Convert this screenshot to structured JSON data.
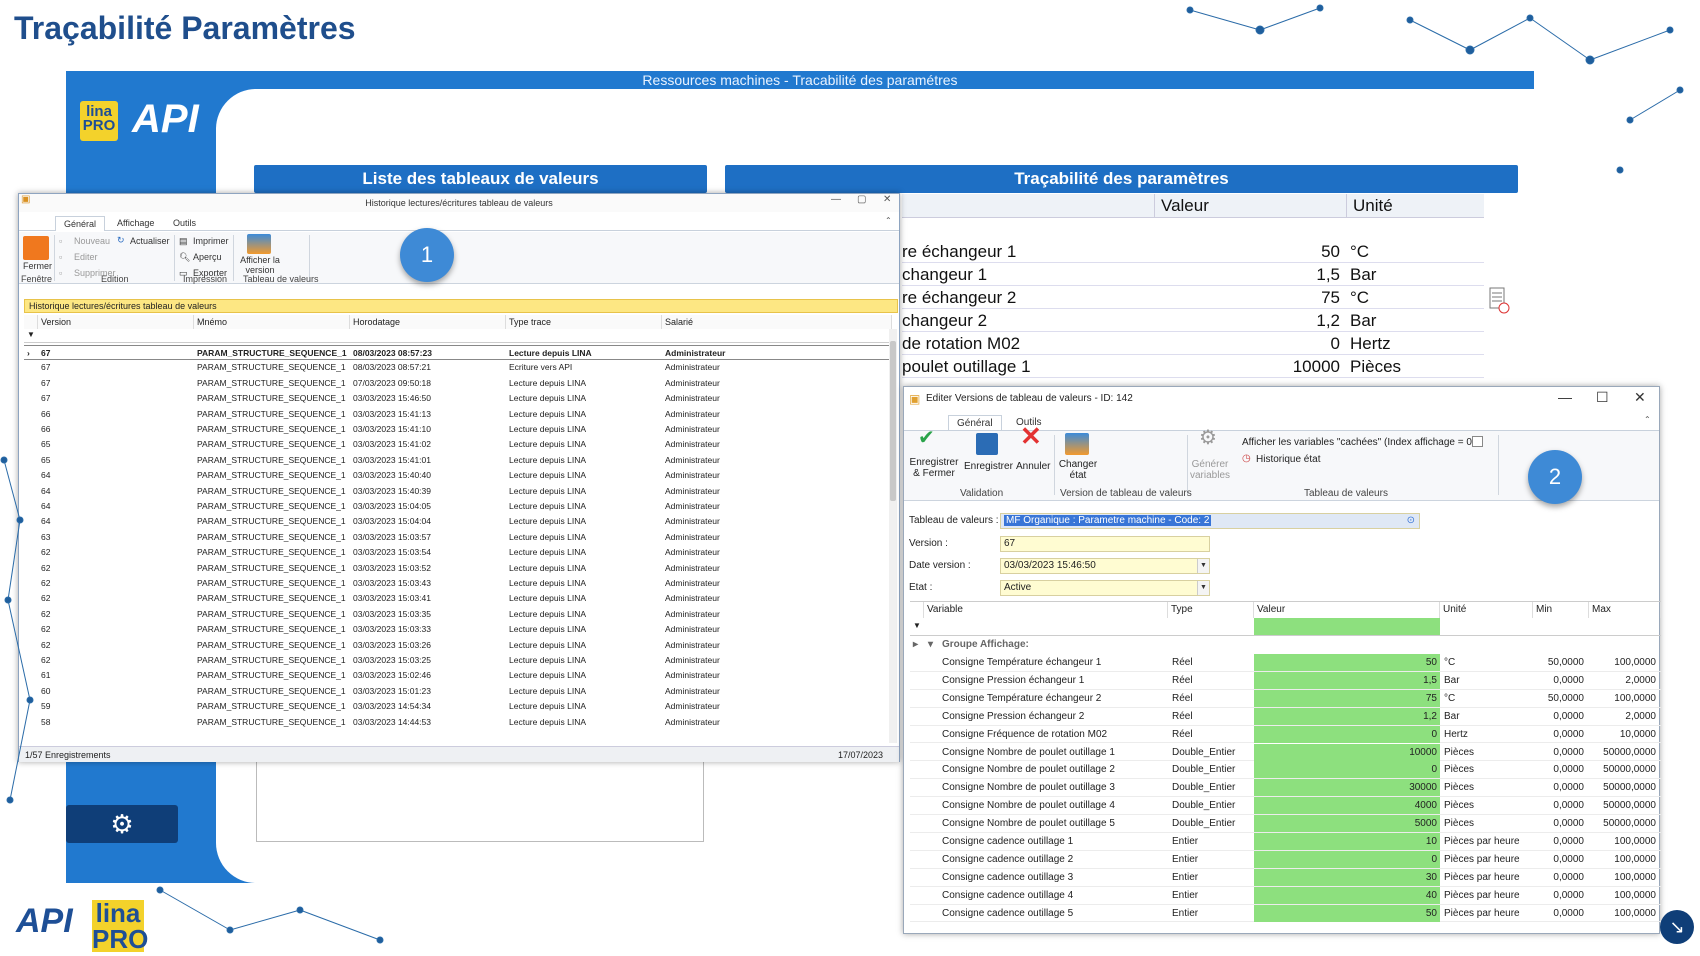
{
  "slide_title": "Traçabilité Paramètres",
  "bg_app": {
    "title": "Ressources machines - Tracabilité des paramétres",
    "logo_lina": "lina PRO",
    "logo_api": "API",
    "header_left": "Liste des tableaux de valeurs",
    "header_right": "Traçabilité des paramètres",
    "table_headers": {
      "valeur": "Valeur",
      "unite": "Unité"
    },
    "rows": [
      {
        "label": "re échangeur 1",
        "value": "50",
        "unit": "°C"
      },
      {
        "label": "changeur 1",
        "value": "1,5",
        "unit": "Bar"
      },
      {
        "label": "re échangeur 2",
        "value": "75",
        "unit": "°C"
      },
      {
        "label": "changeur 2",
        "value": "1,2",
        "unit": "Bar"
      },
      {
        "label": "de rotation M02",
        "value": "0",
        "unit": "Hertz"
      },
      {
        "label": "poulet outillage 1",
        "value": "10000",
        "unit": "Pièces"
      }
    ]
  },
  "win1": {
    "title": "Historique lectures/écritures tableau de valeurs",
    "tabs": [
      "Général",
      "Affichage",
      "Outils"
    ],
    "ribbon": {
      "fermer": "Fermer",
      "nouveau": "Nouveau",
      "actualiser": "Actualiser",
      "editer": "Editer",
      "supprimer": "Supprimer",
      "imprimer": "Imprimer",
      "apercu": "Aperçu",
      "exporter": "Exporter",
      "afficher_version": "Afficher la version",
      "groups": [
        "Fenêtre",
        "Edition",
        "Impression",
        "Tableau de valeurs"
      ]
    },
    "section_label": "Historique lectures/écritures tableau de valeurs",
    "columns": [
      "Version",
      "Mnémo",
      "Horodatage",
      "Type trace",
      "Salarié"
    ],
    "rows": [
      [
        "67",
        "PARAM_STRUCTURE_SEQUENCE_1",
        "08/03/2023 08:57:23",
        "Lecture depuis LINA",
        "Administrateur"
      ],
      [
        "67",
        "PARAM_STRUCTURE_SEQUENCE_1",
        "08/03/2023 08:57:21",
        "Ecriture vers API",
        "Administrateur"
      ],
      [
        "67",
        "PARAM_STRUCTURE_SEQUENCE_1",
        "07/03/2023 09:50:18",
        "Lecture depuis LINA",
        "Administrateur"
      ],
      [
        "67",
        "PARAM_STRUCTURE_SEQUENCE_1",
        "03/03/2023 15:46:50",
        "Lecture depuis LINA",
        "Administrateur"
      ],
      [
        "66",
        "PARAM_STRUCTURE_SEQUENCE_1",
        "03/03/2023 15:41:13",
        "Lecture depuis LINA",
        "Administrateur"
      ],
      [
        "66",
        "PARAM_STRUCTURE_SEQUENCE_1",
        "03/03/2023 15:41:10",
        "Lecture depuis LINA",
        "Administrateur"
      ],
      [
        "65",
        "PARAM_STRUCTURE_SEQUENCE_1",
        "03/03/2023 15:41:02",
        "Lecture depuis LINA",
        "Administrateur"
      ],
      [
        "65",
        "PARAM_STRUCTURE_SEQUENCE_1",
        "03/03/2023 15:41:01",
        "Lecture depuis LINA",
        "Administrateur"
      ],
      [
        "64",
        "PARAM_STRUCTURE_SEQUENCE_1",
        "03/03/2023 15:40:40",
        "Lecture depuis LINA",
        "Administrateur"
      ],
      [
        "64",
        "PARAM_STRUCTURE_SEQUENCE_1",
        "03/03/2023 15:40:39",
        "Lecture depuis LINA",
        "Administrateur"
      ],
      [
        "64",
        "PARAM_STRUCTURE_SEQUENCE_1",
        "03/03/2023 15:04:05",
        "Lecture depuis LINA",
        "Administrateur"
      ],
      [
        "64",
        "PARAM_STRUCTURE_SEQUENCE_1",
        "03/03/2023 15:04:04",
        "Lecture depuis LINA",
        "Administrateur"
      ],
      [
        "63",
        "PARAM_STRUCTURE_SEQUENCE_1",
        "03/03/2023 15:03:57",
        "Lecture depuis LINA",
        "Administrateur"
      ],
      [
        "62",
        "PARAM_STRUCTURE_SEQUENCE_1",
        "03/03/2023 15:03:54",
        "Lecture depuis LINA",
        "Administrateur"
      ],
      [
        "62",
        "PARAM_STRUCTURE_SEQUENCE_1",
        "03/03/2023 15:03:52",
        "Lecture depuis LINA",
        "Administrateur"
      ],
      [
        "62",
        "PARAM_STRUCTURE_SEQUENCE_1",
        "03/03/2023 15:03:43",
        "Lecture depuis LINA",
        "Administrateur"
      ],
      [
        "62",
        "PARAM_STRUCTURE_SEQUENCE_1",
        "03/03/2023 15:03:41",
        "Lecture depuis LINA",
        "Administrateur"
      ],
      [
        "62",
        "PARAM_STRUCTURE_SEQUENCE_1",
        "03/03/2023 15:03:35",
        "Lecture depuis LINA",
        "Administrateur"
      ],
      [
        "62",
        "PARAM_STRUCTURE_SEQUENCE_1",
        "03/03/2023 15:03:33",
        "Lecture depuis LINA",
        "Administrateur"
      ],
      [
        "62",
        "PARAM_STRUCTURE_SEQUENCE_1",
        "03/03/2023 15:03:26",
        "Lecture depuis LINA",
        "Administrateur"
      ],
      [
        "62",
        "PARAM_STRUCTURE_SEQUENCE_1",
        "03/03/2023 15:03:25",
        "Lecture depuis LINA",
        "Administrateur"
      ],
      [
        "61",
        "PARAM_STRUCTURE_SEQUENCE_1",
        "03/03/2023 15:02:46",
        "Lecture depuis LINA",
        "Administrateur"
      ],
      [
        "60",
        "PARAM_STRUCTURE_SEQUENCE_1",
        "03/03/2023 15:01:23",
        "Lecture depuis LINA",
        "Administrateur"
      ],
      [
        "59",
        "PARAM_STRUCTURE_SEQUENCE_1",
        "03/03/2023 14:54:34",
        "Lecture depuis LINA",
        "Administrateur"
      ],
      [
        "58",
        "PARAM_STRUCTURE_SEQUENCE_1",
        "03/03/2023 14:44:53",
        "Lecture depuis LINA",
        "Administrateur"
      ]
    ],
    "status_left": "1/57 Enregistrements",
    "status_right": "17/07/2023"
  },
  "circle1": "1",
  "circle2": "2",
  "win2": {
    "title": "Editer Versions de tableau de valeurs - ID: 142",
    "tabs": [
      "Général",
      "Outils"
    ],
    "ribbon": {
      "enregistrer_fermer": "Enregistrer & Fermer",
      "enregistrer": "Enregistrer",
      "annuler": "Annuler",
      "changer_etat": "Changer état",
      "generer_variables": "Générer variables",
      "afficher_cachees": "Afficher les variables \"cachées\" (Index affichage = 0)",
      "historique_etat": "Historique état",
      "groups": [
        "Validation",
        "Version de tableau de valeurs",
        "Tableau de valeurs"
      ]
    },
    "fields": {
      "tableau_label": "Tableau de valeurs :",
      "tableau_value": "MF Organique : Parametre machine - Code: 2",
      "version_label": "Version :",
      "version_value": "67",
      "date_label": "Date version :",
      "date_value": "03/03/2023 15:46:50",
      "etat_label": "Etat :",
      "etat_value": "Active"
    },
    "columns": [
      "Variable",
      "Type",
      "Valeur",
      "Unité",
      "Min",
      "Max"
    ],
    "group_label": "Groupe Affichage:",
    "rows": [
      [
        "Consigne Température échangeur 1",
        "Réel",
        "50",
        "°C",
        "50,0000",
        "100,0000"
      ],
      [
        "Consigne Pression échangeur 1",
        "Réel",
        "1,5",
        "Bar",
        "0,0000",
        "2,0000"
      ],
      [
        "Consigne Température échangeur 2",
        "Réel",
        "75",
        "°C",
        "50,0000",
        "100,0000"
      ],
      [
        "Consigne Pression échangeur 2",
        "Réel",
        "1,2",
        "Bar",
        "0,0000",
        "2,0000"
      ],
      [
        "Consigne Fréquence de rotation M02",
        "Réel",
        "0",
        "Hertz",
        "0,0000",
        "10,0000"
      ],
      [
        "Consigne Nombre de poulet outillage 1",
        "Double_Entier",
        "10000",
        "Pièces",
        "0,0000",
        "50000,0000"
      ],
      [
        "Consigne Nombre de poulet outillage 2",
        "Double_Entier",
        "0",
        "Pièces",
        "0,0000",
        "50000,0000"
      ],
      [
        "Consigne Nombre de poulet outillage 3",
        "Double_Entier",
        "30000",
        "Pièces",
        "0,0000",
        "50000,0000"
      ],
      [
        "Consigne Nombre de poulet outillage 4",
        "Double_Entier",
        "4000",
        "Pièces",
        "0,0000",
        "50000,0000"
      ],
      [
        "Consigne Nombre de poulet outillage 5",
        "Double_Entier",
        "5000",
        "Pièces",
        "0,0000",
        "50000,0000"
      ],
      [
        "Consigne cadence outillage 1",
        "Entier",
        "10",
        "Pièces par heure",
        "0,0000",
        "100,0000"
      ],
      [
        "Consigne cadence outillage 2",
        "Entier",
        "0",
        "Pièces par heure",
        "0,0000",
        "100,0000"
      ],
      [
        "Consigne cadence outillage 3",
        "Entier",
        "30",
        "Pièces par heure",
        "0,0000",
        "100,0000"
      ],
      [
        "Consigne cadence outillage 4",
        "Entier",
        "40",
        "Pièces par heure",
        "0,0000",
        "100,0000"
      ],
      [
        "Consigne cadence outillage 5",
        "Entier",
        "50",
        "Pièces par heure",
        "0,0000",
        "100,0000"
      ]
    ]
  },
  "bottom_logo": {
    "api": "API",
    "lina": "lina PRO"
  },
  "colors": {
    "accent": "#1e6fc4",
    "title": "#1f4e8c",
    "green": "#8de07e",
    "yellow": "#fde783"
  }
}
